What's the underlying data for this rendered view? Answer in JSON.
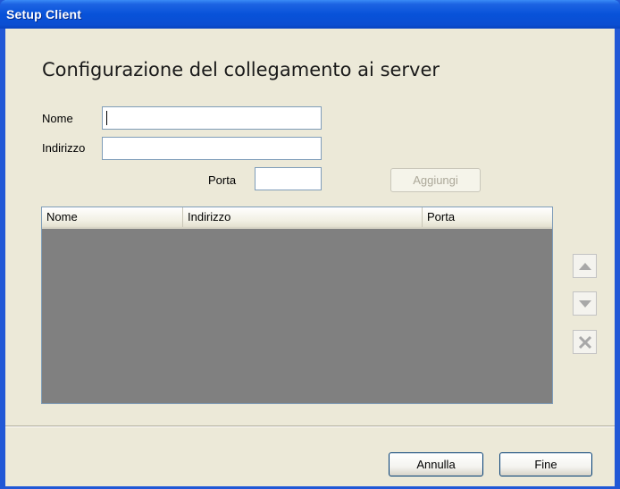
{
  "window": {
    "title": "Setup Client"
  },
  "heading": "Configurazione del collegamento ai server",
  "form": {
    "name_label": "Nome",
    "name_value": "",
    "address_label": "Indirizzo",
    "address_value": "",
    "port_label": "Porta",
    "port_value": "",
    "add_button": "Aggiungi"
  },
  "list": {
    "columns": [
      "Nome",
      "Indirizzo",
      "Porta"
    ],
    "rows": []
  },
  "side_buttons": {
    "up_icon": "arrow-up-icon",
    "down_icon": "arrow-down-icon",
    "delete_icon": "close-icon"
  },
  "footer": {
    "cancel_button": "Annulla",
    "finish_button": "Fine"
  }
}
